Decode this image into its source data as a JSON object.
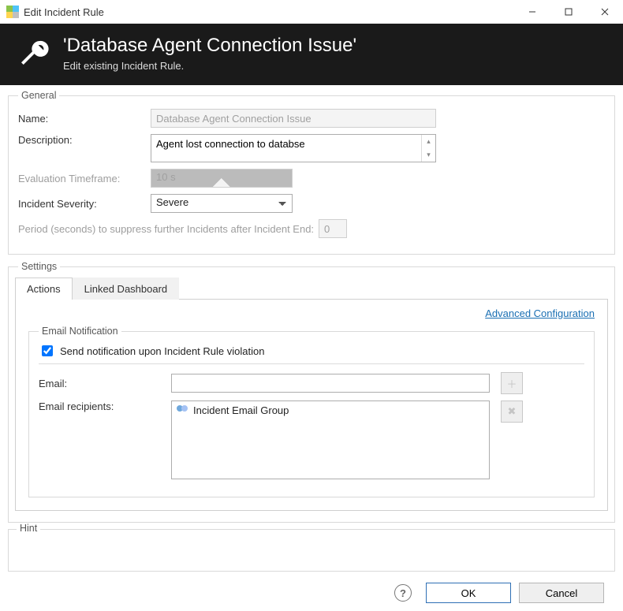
{
  "window": {
    "title": "Edit Incident Rule"
  },
  "header": {
    "title": "'Database Agent Connection Issue'",
    "subtitle": "Edit existing Incident Rule."
  },
  "general": {
    "legend": "General",
    "name_label": "Name:",
    "name_value": "Database Agent Connection Issue",
    "description_label": "Description:",
    "description_value": "Agent lost connection to databse",
    "eval_label": "Evaluation Timeframe:",
    "eval_value": "10 s",
    "severity_label": "Incident Severity:",
    "severity_value": "Severe",
    "suppress_label": "Period (seconds) to suppress further Incidents after Incident End:",
    "suppress_value": "0"
  },
  "settings": {
    "legend": "Settings",
    "tabs": {
      "actions": "Actions",
      "linked": "Linked Dashboard"
    },
    "advanced_link": "Advanced Configuration",
    "email_notification": {
      "legend": "Email Notification",
      "send_checkbox_label": "Send notification upon Incident Rule violation",
      "send_checked": true,
      "email_label": "Email:",
      "email_value": "",
      "recipients_label": "Email recipients:",
      "recipients": [
        "Incident Email Group"
      ]
    }
  },
  "hint": {
    "legend": "Hint",
    "text": ""
  },
  "footer": {
    "ok": "OK",
    "cancel": "Cancel"
  }
}
